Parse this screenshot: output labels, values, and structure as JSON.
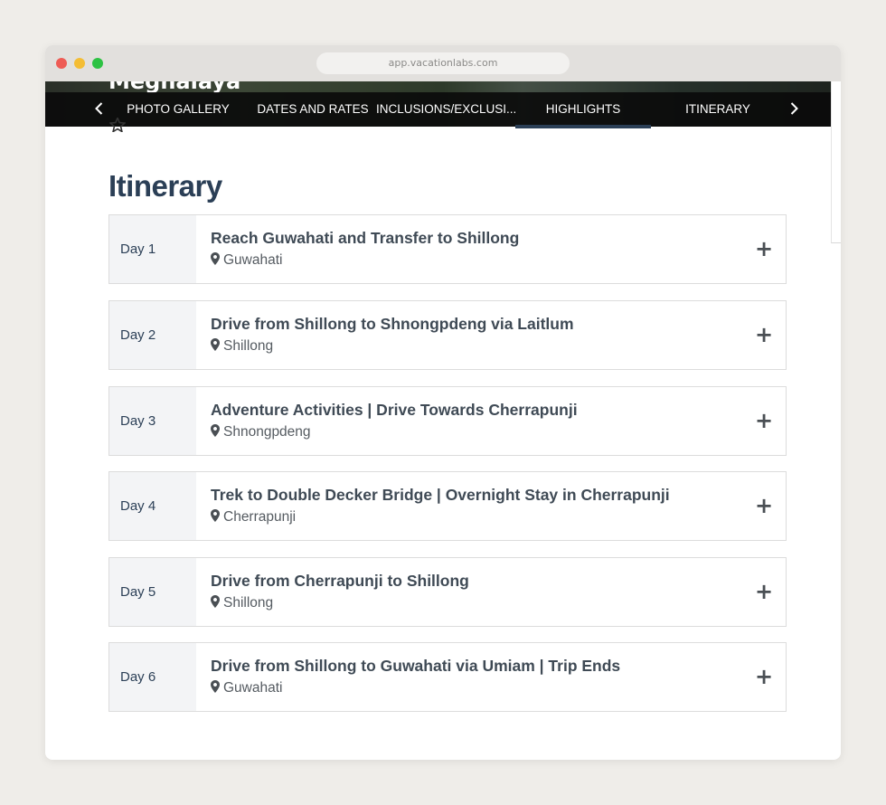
{
  "browser": {
    "url": "app.vacationlabs.com"
  },
  "hero": {
    "title": "Meghalaya",
    "right_text": "..."
  },
  "nav": {
    "prev_icon": "chevron-left-icon",
    "next_icon": "chevron-right-icon",
    "tabs": [
      {
        "label": "PHOTO GALLERY",
        "active": false
      },
      {
        "label": "DATES AND RATES",
        "active": false
      },
      {
        "label": "INCLUSIONS/EXCLUSI...",
        "active": false
      },
      {
        "label": "HIGHLIGHTS",
        "active": true
      },
      {
        "label": "ITINERARY",
        "active": false
      }
    ]
  },
  "itinerary": {
    "heading": "Itinerary",
    "days": [
      {
        "day": "Day 1",
        "title": "Reach Guwahati and Transfer to Shillong",
        "location": "Guwahati"
      },
      {
        "day": "Day 2",
        "title": "Drive from Shillong to Shnongpdeng via Laitlum",
        "location": "Shillong"
      },
      {
        "day": "Day 3",
        "title": "Adventure Activities | Drive Towards Cherrapunji",
        "location": "Shnongpdeng"
      },
      {
        "day": "Day 4",
        "title": "Trek to Double Decker Bridge | Overnight Stay in Cherrapunji",
        "location": "Cherrapunji"
      },
      {
        "day": "Day 5",
        "title": "Drive from Cherrapunji to Shillong",
        "location": "Shillong"
      },
      {
        "day": "Day 6",
        "title": "Drive from Shillong to Guwahati via Umiam | Trip Ends",
        "location": "Guwahati"
      }
    ],
    "expand_symbol": "+"
  },
  "colors": {
    "heading": "#2b3f56",
    "active_tab_underline": "#2b3f56",
    "day_label_bg": "#f3f4f6"
  }
}
